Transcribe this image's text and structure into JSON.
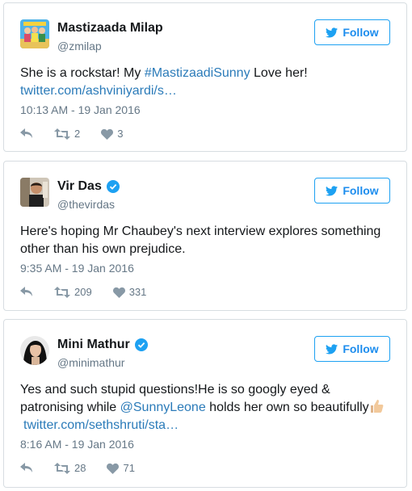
{
  "tweets": [
    {
      "name": "Mastizaada Milap",
      "handle": "@zmilap",
      "verified": false,
      "follow_label": "Follow",
      "text_plain": "She is a rockstar! My ",
      "hashtag": "#MastizaadiSunny",
      "text_after": " Love her!",
      "link": "twitter.com/ashviniyardi/s…",
      "timestamp": "10:13 AM - 19 Jan 2016",
      "retweets": "2",
      "likes": "3"
    },
    {
      "name": "Vir Das",
      "handle": "@thevirdas",
      "verified": true,
      "follow_label": "Follow",
      "text": "Here's hoping Mr Chaubey's next  interview explores something other than his own prejudice.",
      "timestamp": "9:35 AM - 19 Jan 2016",
      "retweets": "209",
      "likes": "331"
    },
    {
      "name": "Mini Mathur",
      "handle": "@minimathur",
      "verified": true,
      "follow_label": "Follow",
      "text_plain": "Yes and such stupid questions!He is so googly eyed & patronising while ",
      "mention": "@SunnyLeone",
      "text_after": " holds her own so beautifully",
      "link": "twitter.com/sethshruti/sta…",
      "timestamp": "8:16 AM - 19 Jan 2016",
      "retweets": "28",
      "likes": "71"
    }
  ],
  "icons": {
    "reply": "reply-icon",
    "retweet": "retweet-icon",
    "like": "heart-icon",
    "follow": "twitter-bird-icon",
    "verified": "verified-badge-icon",
    "emoji": "thumbs-up-emoji"
  },
  "colors": {
    "accent": "#1da1f2",
    "link": "#2b7bb9",
    "muted": "#657786",
    "border": "#d7dde1"
  }
}
